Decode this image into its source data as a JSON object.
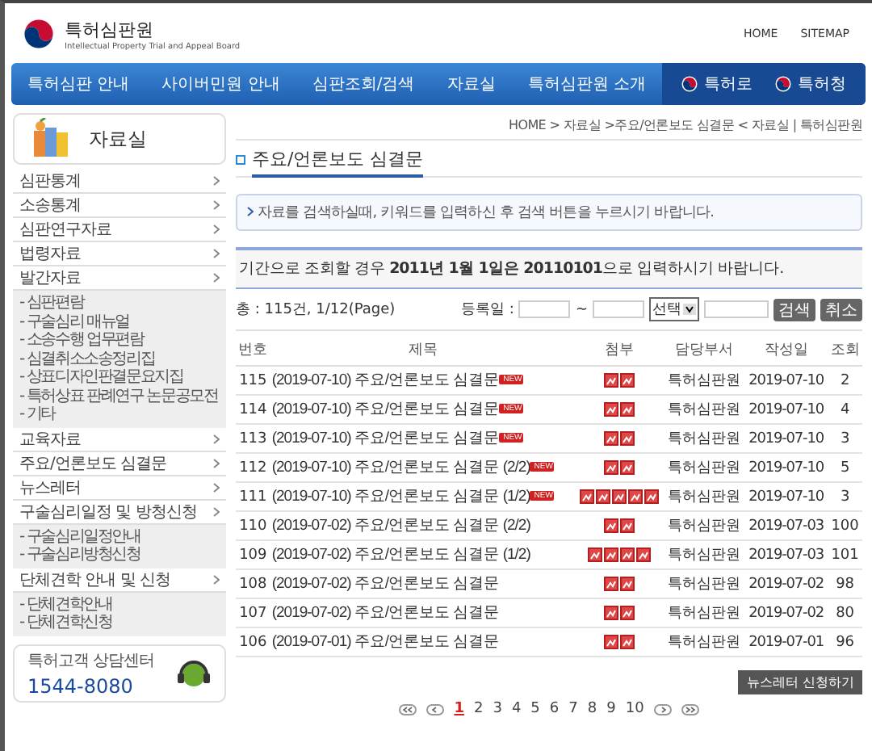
{
  "header": {
    "logo_title": "특허심판원",
    "logo_subtitle": "Intellectual Property Trial and Appeal Board",
    "top_links": [
      "HOME",
      "SITEMAP"
    ],
    "nav": [
      "특허심판 안내",
      "사이버민원 안내",
      "심판조회/검색",
      "자료실",
      "특허심판원 소개"
    ],
    "nav_right": [
      "특허로",
      "특허청"
    ]
  },
  "sidebar": {
    "title": "자료실",
    "menu": [
      {
        "label": "심판통계"
      },
      {
        "label": "소송통계"
      },
      {
        "label": "심판연구자료"
      },
      {
        "label": "법령자료"
      },
      {
        "label": "발간자료",
        "children": [
          "- 심판편람",
          "- 구술심리 매뉴얼",
          "- 소송수행 업무편람",
          "- 심결취소소송정리집",
          "- 상표디자인판결문요지집",
          "- 특허상표 판례연구 논문공모전",
          "- 기타"
        ]
      },
      {
        "label": "교육자료"
      },
      {
        "label": "주요/언론보도 심결문"
      },
      {
        "label": "뉴스레터"
      },
      {
        "label": "구술심리일정 및 방청신청",
        "children": [
          "- 구술심리일정안내",
          "- 구술심리방청신청"
        ]
      },
      {
        "label": "단체견학 안내 및 신청",
        "children": [
          "- 단체견학안내",
          "- 단체견학신청"
        ]
      }
    ],
    "callcenter": {
      "label": "특허고객 상담센터",
      "phone": "1544-8080"
    }
  },
  "content": {
    "breadcrumb": "HOME > 자료실 >주요/언론보도 심결문 < 자료실 | 특허심판원",
    "page_title": "주요/언론보도 심결문",
    "info": "자료를 검색하실때, 키워드를 입력하신 후 검색 버튼을 누르시기 바랍니다.",
    "notice": "기간으로 조회할 경우 **2011년 1월 1일은 20110101**으로 입력하시기 바랍니다.",
    "search": {
      "total": "총 : 115건, 1/12(Page)",
      "date_label": "등록일 :",
      "tilde": "~",
      "select": "선택",
      "buttons": [
        "검색",
        "취소"
      ]
    },
    "table": {
      "columns": [
        "번호",
        "제목",
        "첨부",
        "담당부서",
        "작성일",
        "조회"
      ],
      "rows": [
        {
          "no": "115",
          "title": "(2019-07-10) 주요/언론보도 심결문",
          "badge": "NEW",
          "attachments": [
            {
              "kind": "file"
            },
            {
              "kind": "file"
            }
          ],
          "dept": "특허심판원",
          "date": "2019-07-10",
          "views": "2"
        },
        {
          "no": "114",
          "title": "(2019-07-10) 주요/언론보도 심결문",
          "badge": "NEW",
          "attachments": [
            {
              "kind": "file"
            },
            {
              "kind": "file"
            }
          ],
          "dept": "특허심판원",
          "date": "2019-07-10",
          "views": "4"
        },
        {
          "no": "113",
          "title": "(2019-07-10) 주요/언론보도 심결문",
          "badge": "NEW",
          "attachments": [
            {
              "kind": "file"
            },
            {
              "kind": "file"
            }
          ],
          "dept": "특허심판원",
          "date": "2019-07-10",
          "views": "3"
        },
        {
          "no": "112",
          "title": "(2019-07-10) 주요/언론보도 심결문 (2/2)",
          "badge": "NEW",
          "attachments": [
            {
              "kind": "file"
            },
            {
              "kind": "file"
            }
          ],
          "dept": "특허심판원",
          "date": "2019-07-10",
          "views": "5"
        },
        {
          "no": "111",
          "title": "(2019-07-10) 주요/언론보도 심결문 (1/2)",
          "badge": "NEW",
          "attachments": [
            {
              "kind": "file"
            },
            {
              "kind": "file"
            },
            {
              "kind": "file"
            },
            {
              "kind": "file"
            },
            {
              "kind": "file"
            }
          ],
          "dept": "특허심판원",
          "date": "2019-07-10",
          "views": "3"
        },
        {
          "no": "110",
          "title": "(2019-07-02) 주요/언론보도 심결문 (2/2)",
          "attachments": [
            {
              "kind": "file"
            },
            {
              "kind": "file"
            }
          ],
          "dept": "특허심판원",
          "date": "2019-07-03",
          "views": "100"
        },
        {
          "no": "109",
          "title": "(2019-07-02) 주요/언론보도 심결문 (1/2)",
          "attachments": [
            {
              "kind": "file"
            },
            {
              "kind": "file"
            },
            {
              "kind": "file"
            },
            {
              "kind": "file"
            }
          ],
          "dept": "특허심판원",
          "date": "2019-07-03",
          "views": "101"
        },
        {
          "no": "108",
          "title": "(2019-07-02) 주요/언론보도 심결문",
          "attachments": [
            {
              "kind": "file"
            },
            {
              "kind": "file"
            }
          ],
          "dept": "특허심판원",
          "date": "2019-07-02",
          "views": "98"
        },
        {
          "no": "107",
          "title": "(2019-07-02) 주요/언론보도 심결문",
          "attachments": [
            {
              "kind": "file"
            },
            {
              "kind": "file"
            }
          ],
          "dept": "특허심판원",
          "date": "2019-07-02",
          "views": "80"
        },
        {
          "no": "106",
          "title": "(2019-07-01) 주요/언론보도 심결문",
          "attachments": [
            {
              "kind": "file"
            },
            {
              "kind": "file"
            }
          ],
          "dept": "특허심판원",
          "date": "2019-07-01",
          "views": "96"
        }
      ]
    },
    "newsletter_button": "뉴스레터 신청하기",
    "pagination": [
      {
        "label": "1",
        "selected": true
      },
      {
        "label": "2",
        "selected": false
      },
      {
        "label": "3",
        "selected": false
      },
      {
        "label": "4",
        "selected": false
      },
      {
        "label": "5",
        "selected": false
      },
      {
        "label": "6",
        "selected": false
      },
      {
        "label": "7",
        "selected": false
      },
      {
        "label": "8",
        "selected": false
      },
      {
        "label": "9",
        "selected": false
      },
      {
        "label": "10",
        "selected": false
      }
    ]
  }
}
